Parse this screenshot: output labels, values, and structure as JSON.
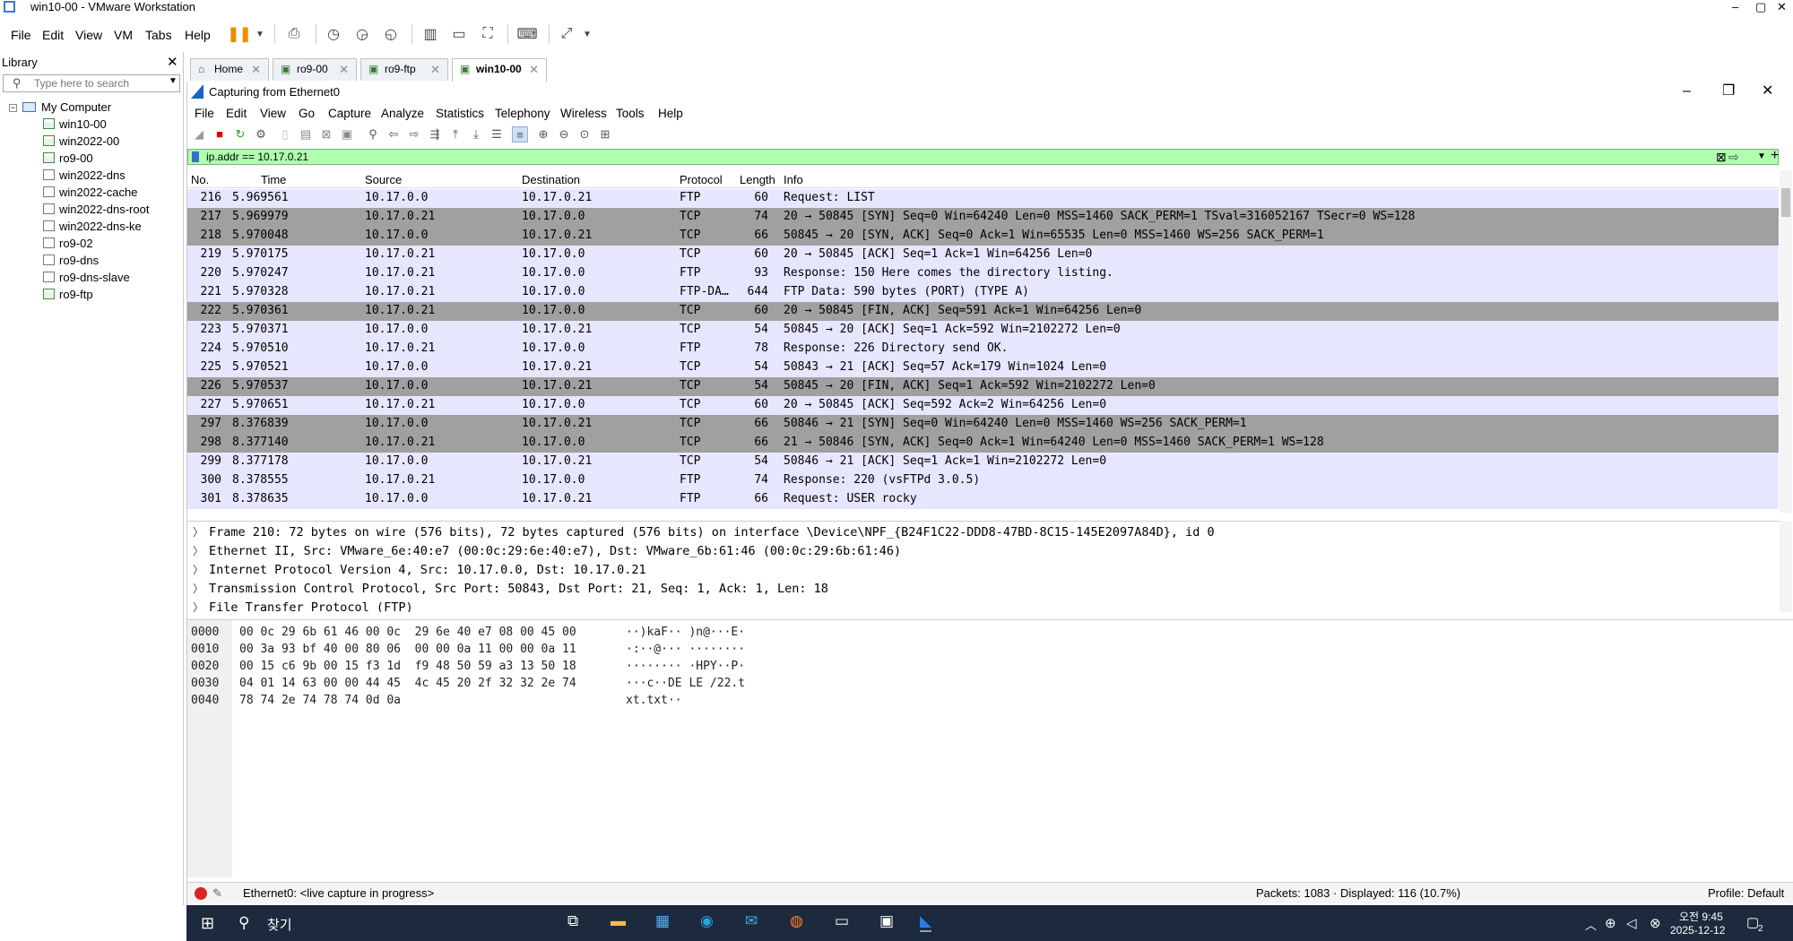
{
  "window": {
    "title": "win10-00 - VMware Workstation",
    "min": "–",
    "max": "▢",
    "close": "✕"
  },
  "vmmenu": [
    "File",
    "Edit",
    "View",
    "VM",
    "Tabs",
    "Help"
  ],
  "library": {
    "title": "Library",
    "close": "✕",
    "search_placeholder": "Type here to search",
    "root": "My Computer",
    "items": [
      "win10-00",
      "win2022-00",
      "ro9-00",
      "win2022-dns",
      "win2022-cache",
      "win2022-dns-root",
      "win2022-dns-ke",
      "ro9-02",
      "ro9-dns",
      "ro9-dns-slave",
      "ro9-ftp"
    ]
  },
  "tabs": [
    {
      "label": "Home"
    },
    {
      "label": "ro9-00"
    },
    {
      "label": "ro9-ftp"
    },
    {
      "label": "win10-00"
    }
  ],
  "ws": {
    "title": "Capturing from Ethernet0",
    "menu": [
      "File",
      "Edit",
      "View",
      "Go",
      "Capture",
      "Analyze",
      "Statistics",
      "Telephony",
      "Wireless",
      "Tools",
      "Help"
    ],
    "filter": "ip.addr == 10.17.0.21",
    "columns": {
      "no": "No.",
      "time": "Time",
      "source": "Source",
      "destination": "Destination",
      "protocol": "Protocol",
      "length": "Length",
      "info": "Info"
    },
    "packets": [
      {
        "no": "216",
        "time": "5.969561",
        "src": "10.17.0.0",
        "dst": "10.17.0.21",
        "proto": "FTP",
        "len": "60",
        "info": "Request: LIST",
        "dark": false
      },
      {
        "no": "217",
        "time": "5.969979",
        "src": "10.17.0.21",
        "dst": "10.17.0.0",
        "proto": "TCP",
        "len": "74",
        "info": "20 → 50845 [SYN] Seq=0 Win=64240 Len=0 MSS=1460 SACK_PERM=1 TSval=316052167 TSecr=0 WS=128",
        "dark": true
      },
      {
        "no": "218",
        "time": "5.970048",
        "src": "10.17.0.0",
        "dst": "10.17.0.21",
        "proto": "TCP",
        "len": "66",
        "info": "50845 → 20 [SYN, ACK] Seq=0 Ack=1 Win=65535 Len=0 MSS=1460 WS=256 SACK_PERM=1",
        "dark": true
      },
      {
        "no": "219",
        "time": "5.970175",
        "src": "10.17.0.21",
        "dst": "10.17.0.0",
        "proto": "TCP",
        "len": "60",
        "info": "20 → 50845 [ACK] Seq=1 Ack=1 Win=64256 Len=0",
        "dark": false
      },
      {
        "no": "220",
        "time": "5.970247",
        "src": "10.17.0.21",
        "dst": "10.17.0.0",
        "proto": "FTP",
        "len": "93",
        "info": "Response: 150 Here comes the directory listing.",
        "dark": false
      },
      {
        "no": "221",
        "time": "5.970328",
        "src": "10.17.0.21",
        "dst": "10.17.0.0",
        "proto": "FTP-DA…",
        "len": "644",
        "info": "FTP Data: 590 bytes (PORT) (TYPE A)",
        "dark": false
      },
      {
        "no": "222",
        "time": "5.970361",
        "src": "10.17.0.21",
        "dst": "10.17.0.0",
        "proto": "TCP",
        "len": "60",
        "info": "20 → 50845 [FIN, ACK] Seq=591 Ack=1 Win=64256 Len=0",
        "dark": true
      },
      {
        "no": "223",
        "time": "5.970371",
        "src": "10.17.0.0",
        "dst": "10.17.0.21",
        "proto": "TCP",
        "len": "54",
        "info": "50845 → 20 [ACK] Seq=1 Ack=592 Win=2102272 Len=0",
        "dark": false
      },
      {
        "no": "224",
        "time": "5.970510",
        "src": "10.17.0.21",
        "dst": "10.17.0.0",
        "proto": "FTP",
        "len": "78",
        "info": "Response: 226 Directory send OK.",
        "dark": false
      },
      {
        "no": "225",
        "time": "5.970521",
        "src": "10.17.0.0",
        "dst": "10.17.0.21",
        "proto": "TCP",
        "len": "54",
        "info": "50843 → 21 [ACK] Seq=57 Ack=179 Win=1024 Len=0",
        "dark": false
      },
      {
        "no": "226",
        "time": "5.970537",
        "src": "10.17.0.0",
        "dst": "10.17.0.21",
        "proto": "TCP",
        "len": "54",
        "info": "50845 → 20 [FIN, ACK] Seq=1 Ack=592 Win=2102272 Len=0",
        "dark": true
      },
      {
        "no": "227",
        "time": "5.970651",
        "src": "10.17.0.21",
        "dst": "10.17.0.0",
        "proto": "TCP",
        "len": "60",
        "info": "20 → 50845 [ACK] Seq=592 Ack=2 Win=64256 Len=0",
        "dark": false
      },
      {
        "no": "297",
        "time": "8.376839",
        "src": "10.17.0.0",
        "dst": "10.17.0.21",
        "proto": "TCP",
        "len": "66",
        "info": "50846 → 21 [SYN] Seq=0 Win=64240 Len=0 MSS=1460 WS=256 SACK_PERM=1",
        "dark": true
      },
      {
        "no": "298",
        "time": "8.377140",
        "src": "10.17.0.21",
        "dst": "10.17.0.0",
        "proto": "TCP",
        "len": "66",
        "info": "21 → 50846 [SYN, ACK] Seq=0 Ack=1 Win=64240 Len=0 MSS=1460 SACK_PERM=1 WS=128",
        "dark": true
      },
      {
        "no": "299",
        "time": "8.377178",
        "src": "10.17.0.0",
        "dst": "10.17.0.21",
        "proto": "TCP",
        "len": "54",
        "info": "50846 → 21 [ACK] Seq=1 Ack=1 Win=2102272 Len=0",
        "dark": false
      },
      {
        "no": "300",
        "time": "8.378555",
        "src": "10.17.0.21",
        "dst": "10.17.0.0",
        "proto": "FTP",
        "len": "74",
        "info": "Response: 220 (vsFTPd 3.0.5)",
        "dark": false
      },
      {
        "no": "301",
        "time": "8.378635",
        "src": "10.17.0.0",
        "dst": "10.17.0.21",
        "proto": "FTP",
        "len": "66",
        "info": "Request: USER rocky",
        "dark": false
      }
    ],
    "details": [
      "Frame 210: 72 bytes on wire (576 bits), 72 bytes captured (576 bits) on interface \\Device\\NPF_{B24F1C22-DDD8-47BD-8C15-145E2097A84D}, id 0",
      "Ethernet II, Src: VMware_6e:40:e7 (00:0c:29:6e:40:e7), Dst: VMware_6b:61:46 (00:0c:29:6b:61:46)",
      "Internet Protocol Version 4, Src: 10.17.0.0, Dst: 10.17.0.21",
      "Transmission Control Protocol, Src Port: 50843, Dst Port: 21, Seq: 1, Ack: 1, Len: 18",
      "File Transfer Protocol (FTP)"
    ],
    "bytes": [
      {
        "off": "0000",
        "hex": "00 0c 29 6b 61 46 00 0c  29 6e 40 e7 08 00 45 00",
        "ascii": "··)kaF·· )n@···E·"
      },
      {
        "off": "0010",
        "hex": "00 3a 93 bf 40 00 80 06  00 00 0a 11 00 00 0a 11",
        "ascii": "·:··@··· ········"
      },
      {
        "off": "0020",
        "hex": "00 15 c6 9b 00 15 f3 1d  f9 48 50 59 a3 13 50 18",
        "ascii": "········ ·HPY··P·"
      },
      {
        "off": "0030",
        "hex": "04 01 14 63 00 00 44 45  4c 45 20 2f 32 32 2e 74",
        "ascii": "···c··DE LE /22.t"
      },
      {
        "off": "0040",
        "hex": "78 74 2e 74 78 74 0d 0a",
        "ascii": "xt.txt··"
      }
    ],
    "status": {
      "iface": "Ethernet0: <live capture in progress>",
      "packets": "Packets: 1083 · Displayed: 116 (10.7%)",
      "profile": "Profile: Default"
    }
  },
  "taskbar": {
    "search": "찾기",
    "time": "오전 9:45",
    "date": "2025-12-12",
    "notif": "2"
  }
}
